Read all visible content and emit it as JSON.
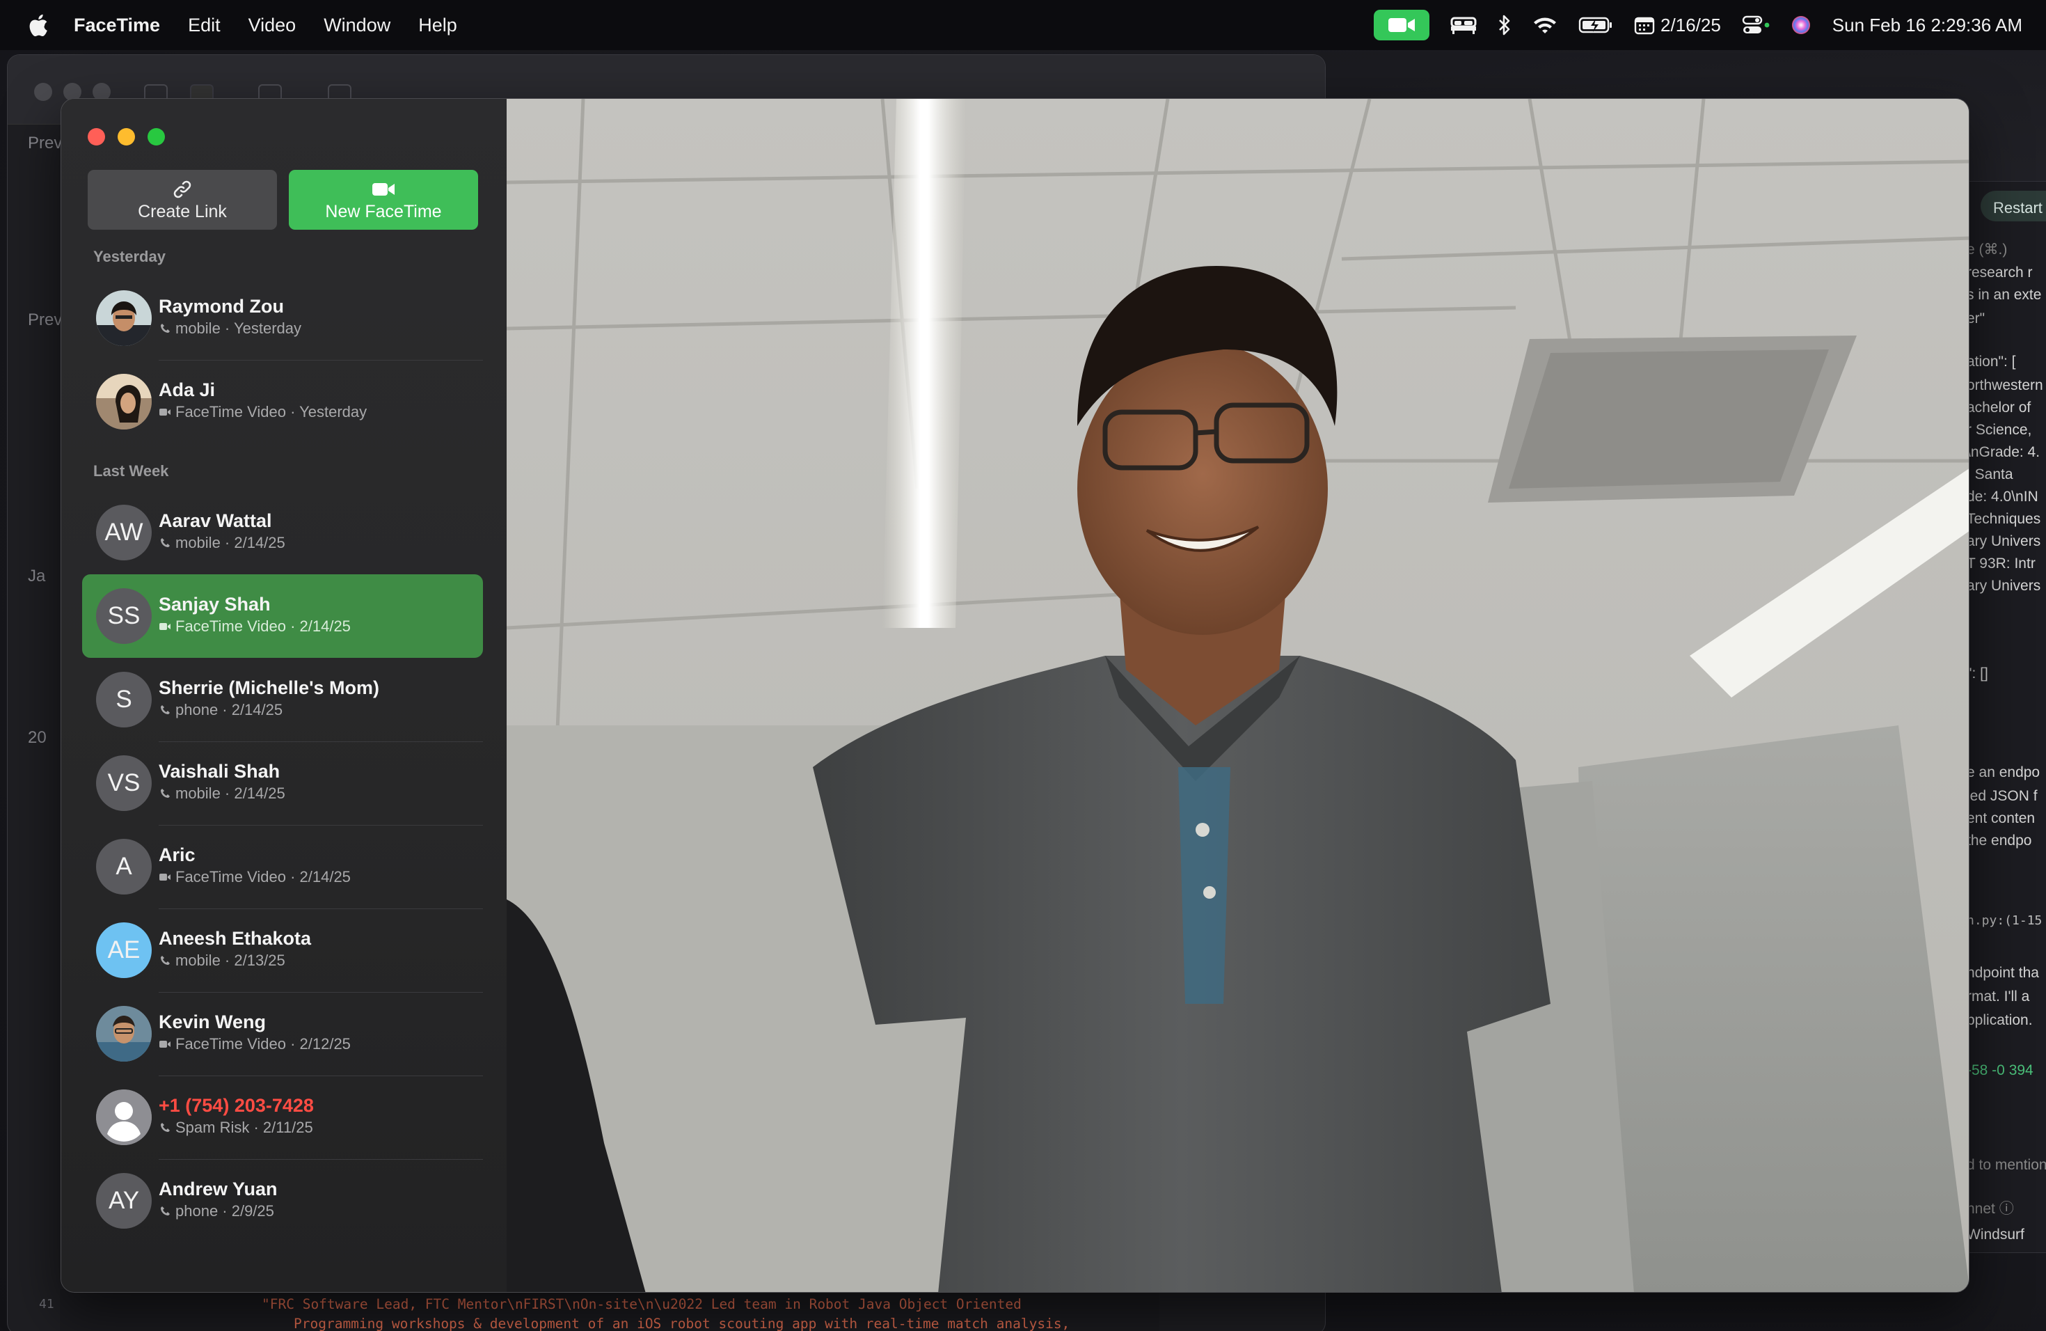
{
  "menubar": {
    "app_name": "FaceTime",
    "menus": [
      "Edit",
      "Video",
      "Window",
      "Help"
    ],
    "status": {
      "calendar_date": "2/16/25",
      "datetime": "Sun Feb 16  2:29:36 AM",
      "icons": [
        "facetime-video-icon",
        "bed-icon",
        "bluetooth-icon",
        "wifi-icon",
        "battery-icon",
        "calendar-icon",
        "control-center-icon",
        "siri-icon"
      ]
    }
  },
  "background": {
    "left_edge_texts": [
      "Prev",
      "Prev",
      "Ja",
      "20"
    ],
    "code_line_number": "41",
    "code_line_1": "\"FRC Software Lead, FTC Mentor\\nFIRST\\nOn-site\\n\\u2022 Led team in Robot Java Object Oriented",
    "code_line_2": "Programming workshops & development of an iOS robot scouting app with real-time match analysis,",
    "right_panel": {
      "restart_label": "Restart",
      "lines": [
        "e (⌘.)",
        " research r",
        "s in an exte",
        "er\"",
        "ation\": [",
        "orthwestern",
        "achelor of",
        "r Science,",
        "\\nGrade: 4.",
        ": Santa",
        "de: 4.0\\nIN",
        "Techniques",
        "ary Univers",
        "T 93R: Intr",
        "ary Univers",
        "\": []",
        "e an endpo",
        "ied JSON f",
        "ent conten",
        "the endpo",
        "n.py:(1-15",
        "ndpoint tha",
        "rmat. I'll a",
        "pplication.",
        "-58 -0  394",
        "d to mention",
        "nnet ⓘ",
        "Windsurf"
      ]
    }
  },
  "facetime": {
    "create_link_label": "Create Link",
    "new_facetime_label": "New FaceTime",
    "sections": [
      {
        "title": "Yesterday",
        "items": [
          {
            "name": "Raymond Zou",
            "detail": "mobile · Yesterday",
            "kind": "phone",
            "avatar_text": ""
          },
          {
            "name": "Ada Ji",
            "detail": "FaceTime Video · Yesterday",
            "kind": "video",
            "avatar_text": ""
          }
        ]
      },
      {
        "title": "Last Week",
        "items": [
          {
            "name": "Aarav Wattal",
            "detail": "mobile · 2/14/25",
            "kind": "phone",
            "avatar_text": "AW"
          },
          {
            "name": "Sanjay Shah",
            "detail": "FaceTime Video · 2/14/25",
            "kind": "video",
            "avatar_text": "SS",
            "selected": true
          },
          {
            "name": "Sherrie (Michelle's Mom)",
            "detail": "phone · 2/14/25",
            "kind": "phone",
            "avatar_text": "S"
          },
          {
            "name": "Vaishali Shah",
            "detail": "mobile · 2/14/25",
            "kind": "phone",
            "avatar_text": "VS"
          },
          {
            "name": "Aric",
            "detail": "FaceTime Video · 2/14/25",
            "kind": "video",
            "avatar_text": "A"
          },
          {
            "name": "Aneesh Ethakota",
            "detail": "mobile · 2/13/25",
            "kind": "phone",
            "avatar_text": "AE"
          },
          {
            "name": "Kevin Weng",
            "detail": "FaceTime Video · 2/12/25",
            "kind": "video",
            "avatar_text": ""
          },
          {
            "name": "+1 (754) 203-7428",
            "detail": "Spam Risk · 2/11/25",
            "kind": "phone",
            "avatar_text": "",
            "spam": true
          },
          {
            "name": "Andrew Yuan",
            "detail": "phone · 2/9/25",
            "kind": "phone",
            "avatar_text": "AY"
          }
        ]
      }
    ]
  },
  "colors": {
    "facetime_green": "#3fbe58",
    "selected_row": "#3f8c45",
    "spam_red": "#ff4c43",
    "close": "#ff5f57",
    "minimize": "#febc2e",
    "zoom": "#28c840"
  }
}
